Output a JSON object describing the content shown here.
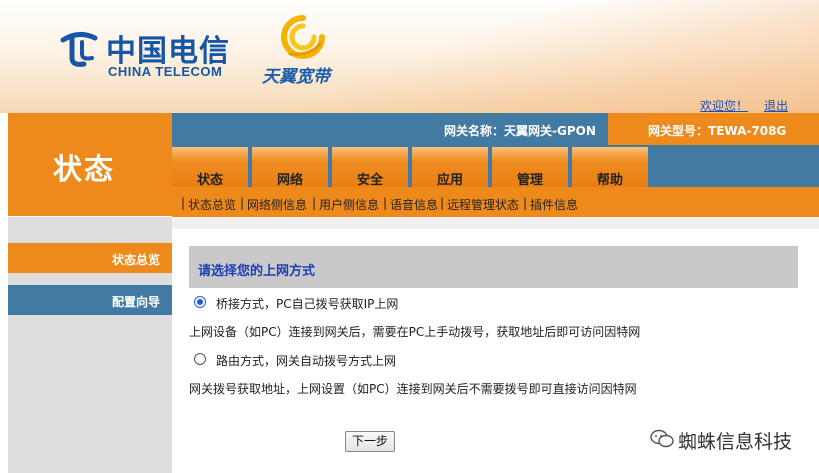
{
  "branding": {
    "logo_cn": "中国电信",
    "logo_en": "CHINA TELECOM",
    "logo_sub": "天翼宽带"
  },
  "top_links": {
    "welcome": "欢迎您！",
    "logout": "退出"
  },
  "section_title": "状态",
  "gateway": {
    "name_label": "网关名称：",
    "name_value": "天翼网关-GPON",
    "model_label": "网关型号：",
    "model_value": "TEWA-708G"
  },
  "tabs": [
    {
      "label": "状态"
    },
    {
      "label": "网络"
    },
    {
      "label": "安全"
    },
    {
      "label": "应用"
    },
    {
      "label": "管理"
    },
    {
      "label": "帮助"
    }
  ],
  "subnav": [
    {
      "label": "状态总览"
    },
    {
      "label": "网络侧信息"
    },
    {
      "label": "用户侧信息"
    },
    {
      "label": "语音信息"
    },
    {
      "label": "远程管理状态"
    },
    {
      "label": "插件信息"
    }
  ],
  "sidebar": {
    "items": [
      {
        "label": "状态总览"
      },
      {
        "label": "配置向导"
      }
    ]
  },
  "main": {
    "heading": "请选择您的上网方式",
    "options": [
      {
        "label": "桥接方式，PC自己拨号获取IP上网",
        "description": "上网设备（如PC）连接到网关后，需要在PC上手动拨号，获取地址后即可访问因特网",
        "selected": true
      },
      {
        "label": "路由方式，网关自动拨号方式上网",
        "description": "网关拨号获取地址，上网设置（如PC）连接到网关后不需要拨号即可直接访问因特网",
        "selected": false
      }
    ],
    "next_button": "下一步"
  },
  "watermark": "蜘蛛信息科技",
  "colors": {
    "orange": "#ee8a1c",
    "steel_blue": "#417aa3",
    "heading_blue": "#1d3fb5",
    "panel_gray": "#dedede"
  }
}
